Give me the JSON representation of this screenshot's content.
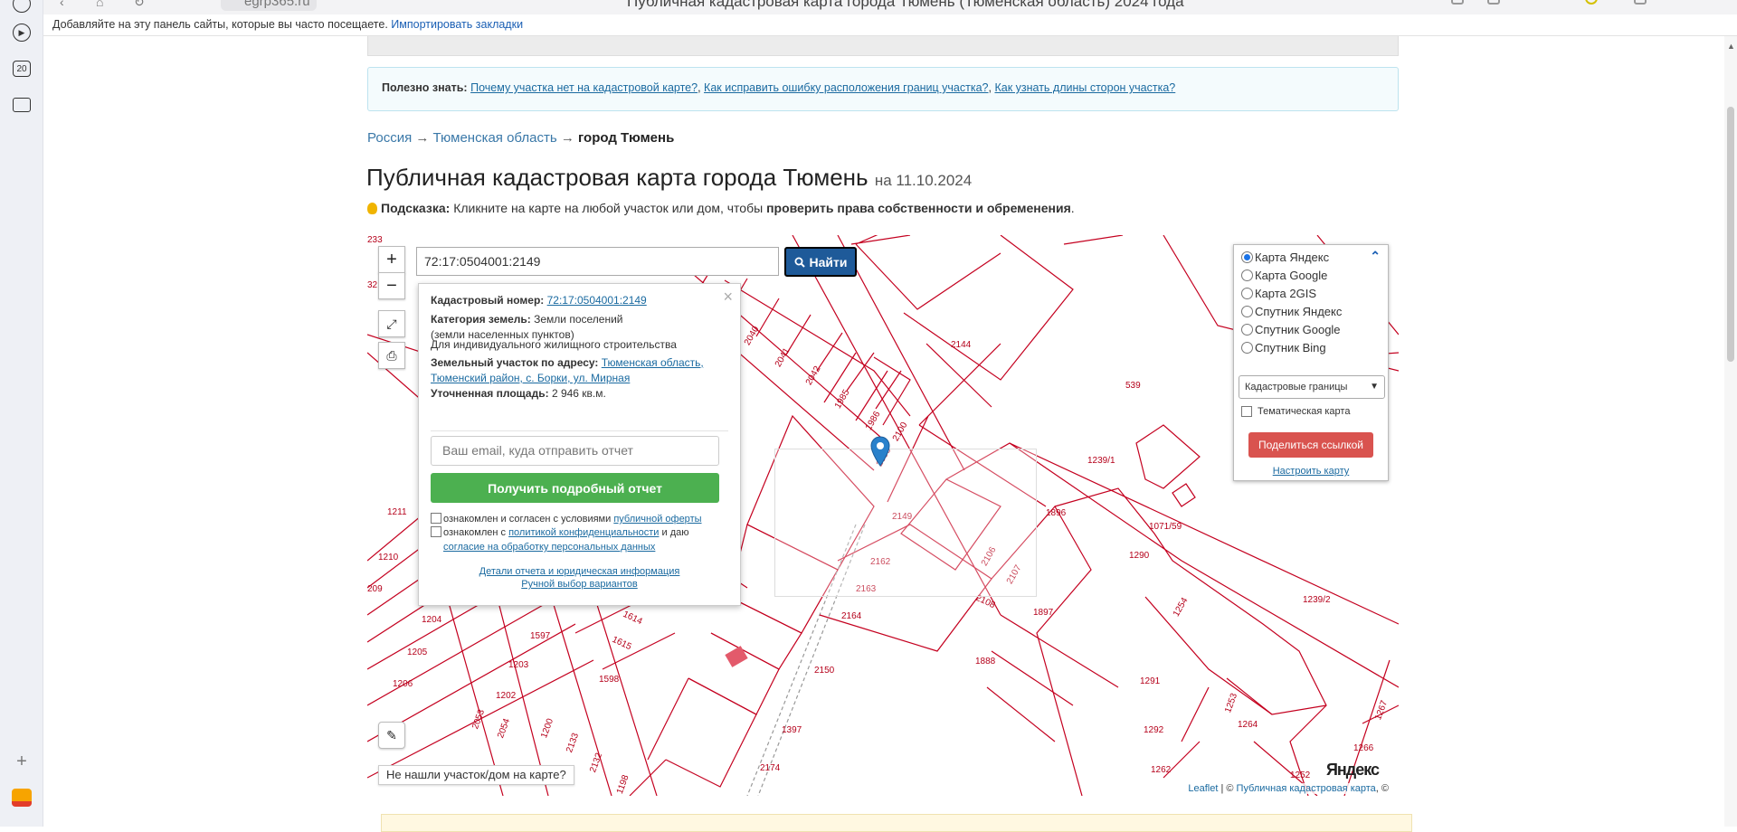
{
  "browser": {
    "tab_title": "Публичная кадастровая карта города Тюмень (Тюменская область) 2024 года",
    "address": "egrp365.ru",
    "bookmarks_prompt": "Добавляйте на эту панель сайты, которые вы часто посещаете.",
    "bookmarks_import": "Импортировать закладки",
    "sidebar_badge": "20"
  },
  "info": {
    "label": "Полезно знать:",
    "links": [
      "Почему участка нет на кадастровой карте?",
      "Как исправить ошибку расположения границ участка?",
      "Как узнать длины сторон участка?"
    ]
  },
  "breadcrumb": {
    "items": [
      "Россия",
      "Тюменская область"
    ],
    "current": "город Тюмень",
    "sep": "→"
  },
  "heading": {
    "title": "Публичная кадастровая карта города Тюмень",
    "date": "на 11.10.2024"
  },
  "hint": {
    "label": "Подсказка:",
    "text": "Кликните на карте на любой участок или дом, чтобы",
    "bold": "проверить права собственности и обременения",
    "end": "."
  },
  "map": {
    "zoom_in": "+",
    "zoom_out": "−",
    "search_value": "72:17:0504001:2149",
    "search_button": "Найти",
    "not_found": "Не нашли участок/дом на карте?",
    "attribution_leaflet": "Leaflet",
    "attribution_sep": " | © ",
    "attribution_pkk": "Публичная кадастровая карта",
    "attribution_end": ", ©",
    "yandex_logo": "Яндекс"
  },
  "popup": {
    "cad_label": "Кадастровый номер:",
    "cad_value": "72:17:0504001:2149",
    "cat_label": "Категория земель:",
    "cat_value": "Земли поселений (земли населенных пунктов)",
    "use_value": "Для индивидуального жилищного строительства",
    "addr_label": "Земельный участок по адресу:",
    "addr_value": "Тюменская область, Тюменский район, с. Борки, ул. Мирная",
    "area_label": "Уточненная площадь:",
    "area_value": "2 946 кв.м.",
    "email_placeholder": "Ваш email, куда отправить отчет",
    "report_button": "Получить подробный отчет",
    "agree1_pre": "ознакомлен и согласен с условиями",
    "agree1_link": "публичной оферты",
    "agree2_pre": "ознакомлен с",
    "agree2_link": "политикой конфиденциальности",
    "agree2_mid": "и даю",
    "agree2_link2": "согласие на обработку персональных данных",
    "details_link": "Детали отчета и юридическая информация",
    "manual_link": "Ручной выбор вариантов",
    "close": "×"
  },
  "layers": {
    "options": [
      "Карта Яндекс",
      "Карта Google",
      "Карта 2GIS",
      "Спутник Яндекс",
      "Спутник Google",
      "Спутник Bing"
    ],
    "selected_index": 0,
    "overlay_select": "Кадастровые границы",
    "thematic": "Тематическая карта",
    "share_button": "Поделиться ссылкой",
    "configure_link": "Настроить карту"
  },
  "parcels": [
    "2038",
    "2039",
    "2040",
    "2041",
    "2042",
    "1985",
    "1986",
    "2100",
    "2099",
    "2144",
    "539",
    "1239/1",
    "1896",
    "1071/59",
    "1290",
    "1254",
    "1239/2",
    "2149",
    "2162",
    "2163",
    "2164",
    "2106",
    "2107",
    "2108",
    "1897",
    "1888",
    "2150",
    "1397",
    "2174",
    "1291",
    "1292",
    "1262",
    "1253",
    "1264",
    "1266",
    "1267",
    "1252",
    "1211",
    "1210",
    "209",
    "1204",
    "1205",
    "1206",
    "1597",
    "1614",
    "1615",
    "1203",
    "1598",
    "1202",
    "2053",
    "2054",
    "1200",
    "2133",
    "2132",
    "1198",
    "233",
    "32"
  ]
}
